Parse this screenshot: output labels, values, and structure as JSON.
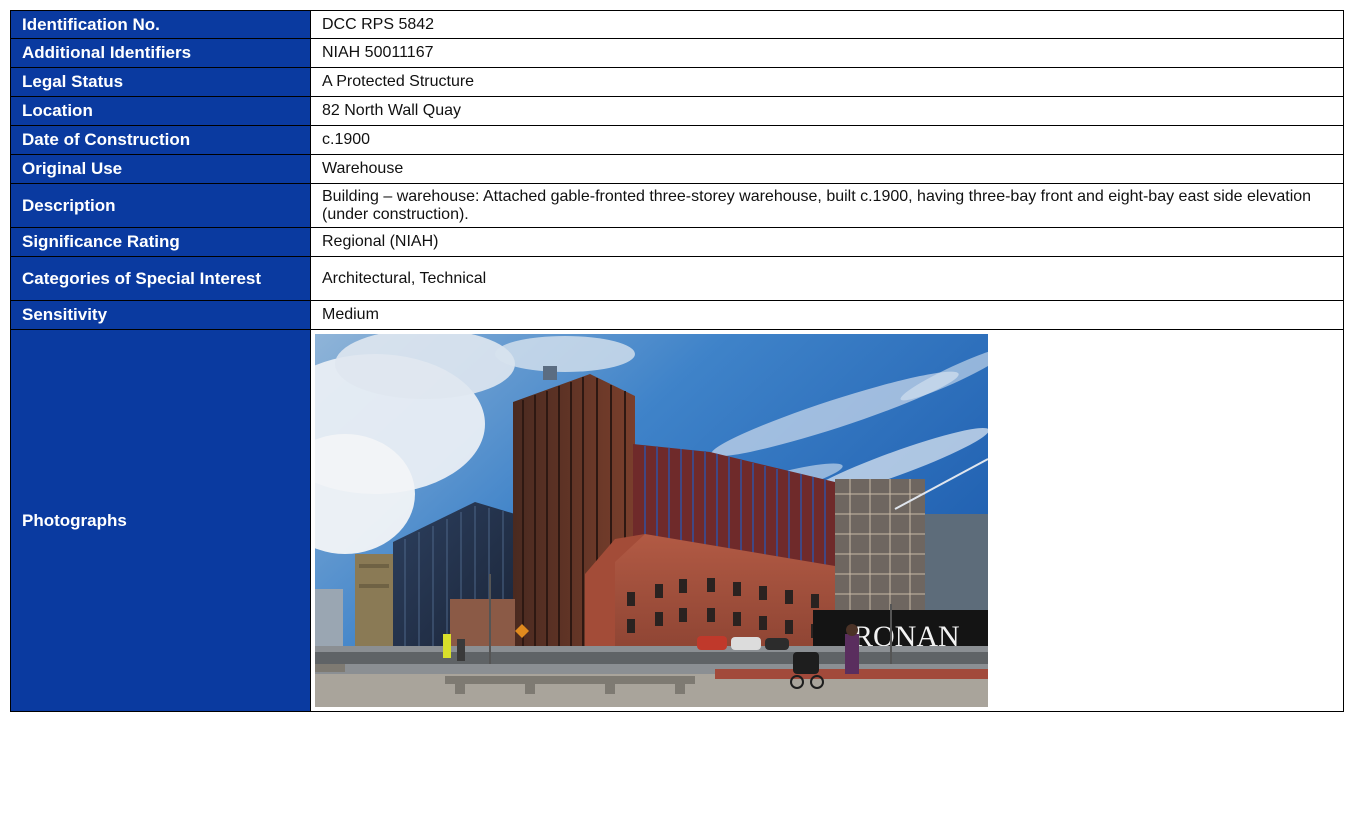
{
  "rows": [
    {
      "label": "Identification No.",
      "value": "DCC RPS 5842"
    },
    {
      "label": "Additional Identifiers",
      "value": "NIAH 50011167"
    },
    {
      "label": "Legal Status",
      "value": "A Protected Structure"
    },
    {
      "label": "Location",
      "value": "82 North Wall Quay"
    },
    {
      "label": "Date of Construction",
      "value": "c.1900"
    },
    {
      "label": "Original Use",
      "value": "Warehouse"
    },
    {
      "label": "Description",
      "value": "Building – warehouse: Attached gable-fronted three-storey warehouse, built c.1900, having three-bay front and eight-bay east side elevation (under construction)."
    },
    {
      "label": "Significance Rating",
      "value": "Regional (NIAH)"
    },
    {
      "label": "Categories of Special Interest",
      "value": "Architectural, Technical"
    },
    {
      "label": "Sensitivity",
      "value": "Medium"
    }
  ],
  "photographs": {
    "label": "Photographs",
    "signage_text": "RONAN"
  }
}
